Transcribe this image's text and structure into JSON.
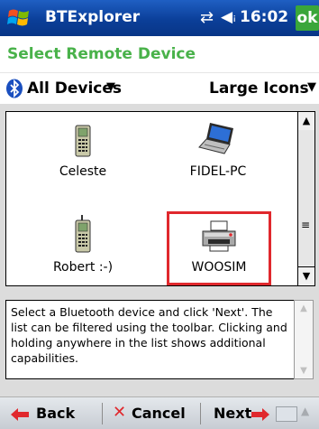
{
  "titlebar": {
    "app_title": "BTExplorer",
    "time": "16:02",
    "ok_label": "ok"
  },
  "heading": "Select Remote Device",
  "toolbar": {
    "filter_label": "All Devices",
    "view_label": "Large Icons"
  },
  "devices": [
    {
      "name": "Celeste",
      "icon": "phone-icon"
    },
    {
      "name": "FIDEL-PC",
      "icon": "laptop-icon"
    },
    {
      "name": "Robert :-)",
      "icon": "phone-icon"
    },
    {
      "name": "WOOSIM",
      "icon": "printer-icon",
      "selected": true
    }
  ],
  "description": "Select a Bluetooth device and click 'Next'. The list can be filtered using the toolbar. Clicking and holding anywhere in the list shows additional capabilities.",
  "menubar": {
    "back_label": "Back",
    "cancel_label": "Cancel",
    "next_label": "Next"
  },
  "colors": {
    "title_bar": "#0b3f99",
    "heading_text": "#49b24a",
    "selection_border": "#e0282d",
    "ok_button": "#3aa63a"
  }
}
